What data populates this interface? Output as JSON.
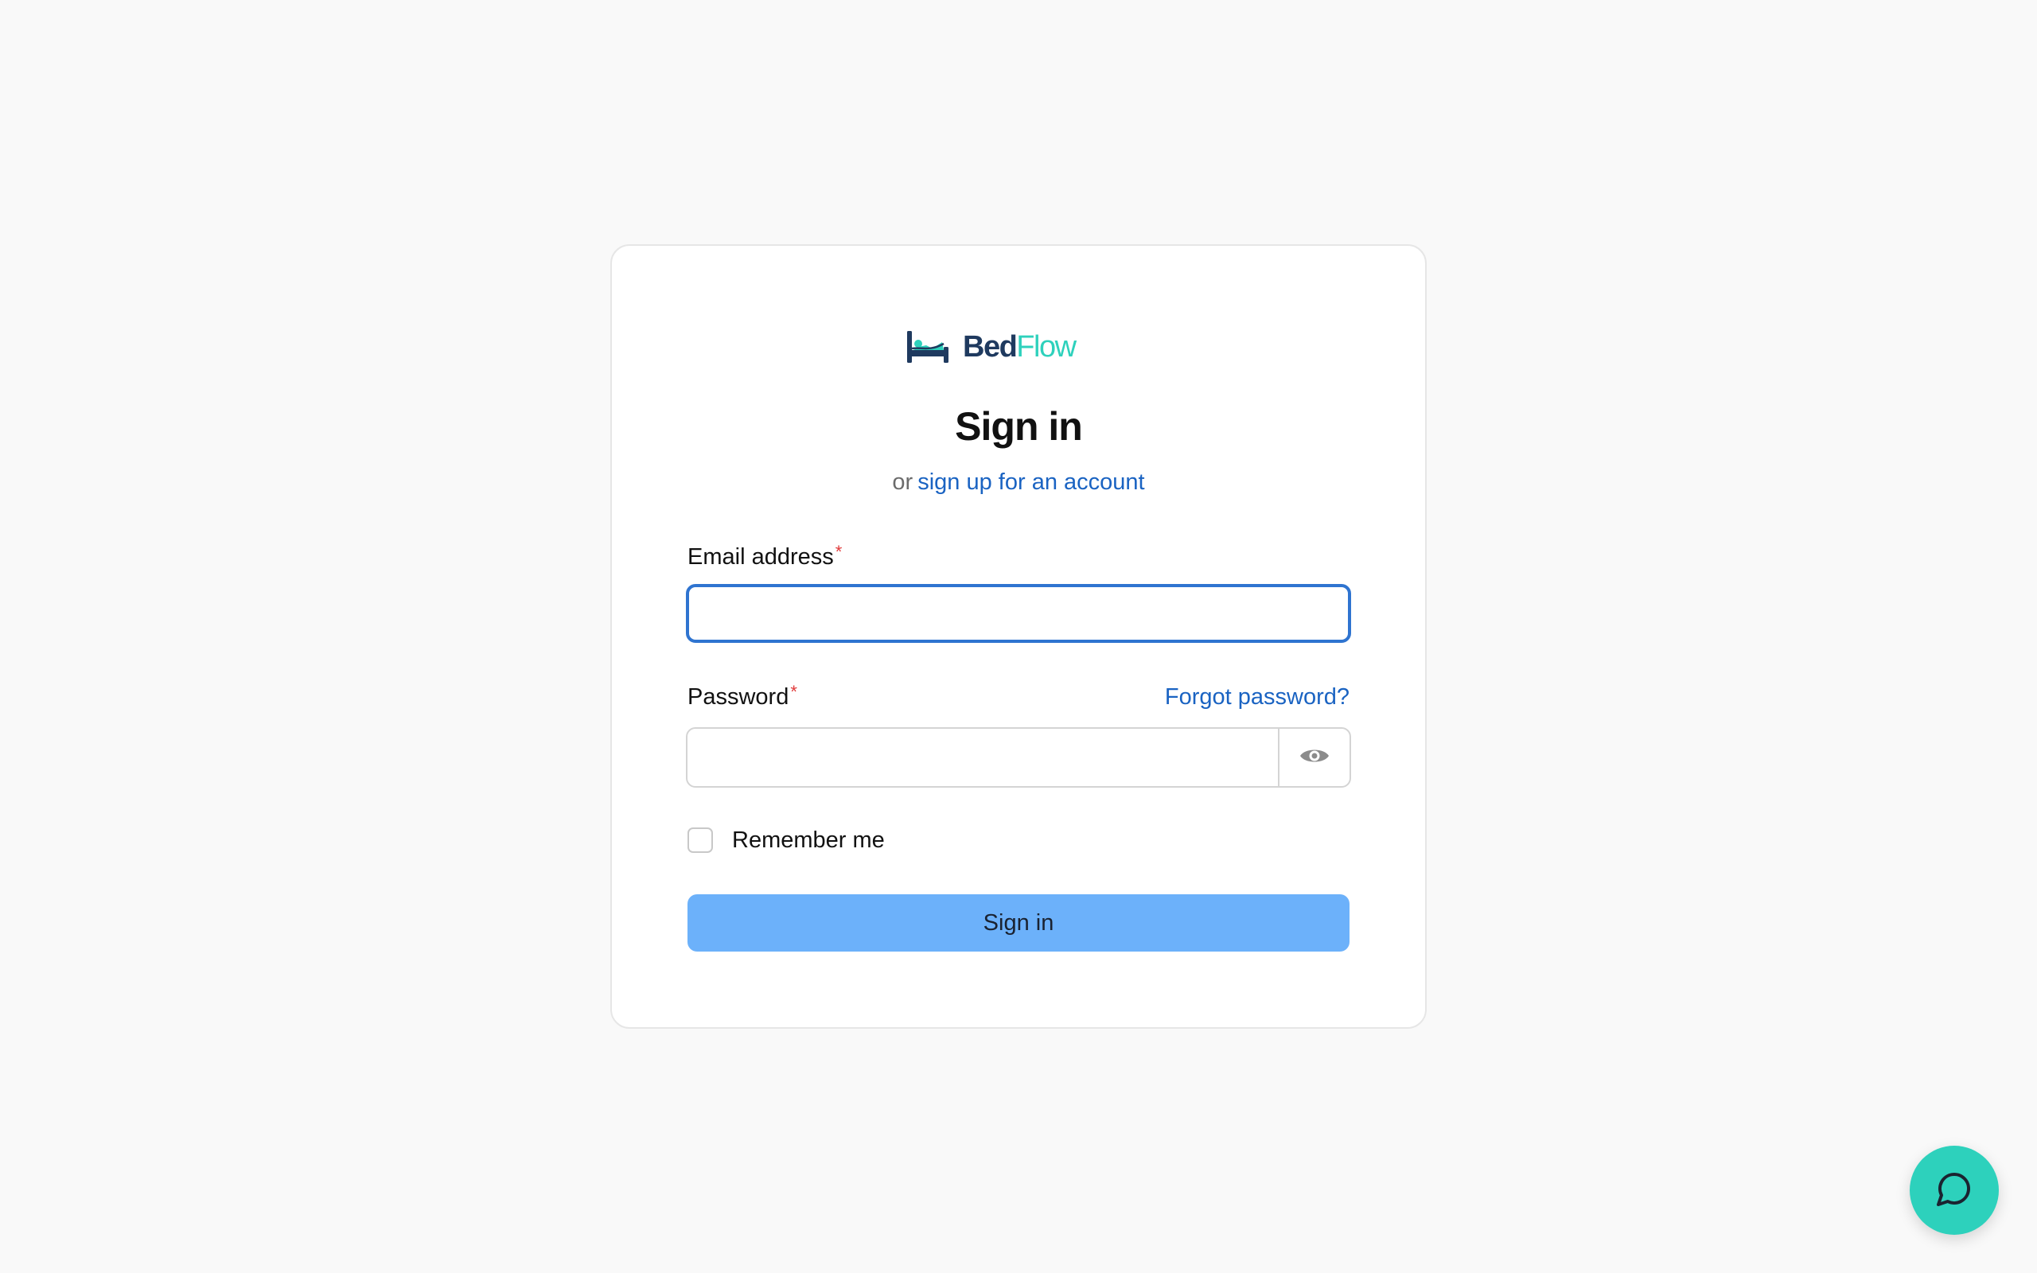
{
  "brand": {
    "name_part1": "Bed",
    "name_part2": "Flow",
    "primary_color": "#1f3a5f",
    "accent_color": "#2ed1bc",
    "logo_icon": "bed-icon"
  },
  "header": {
    "title": "Sign in",
    "subtitle_prefix": "or",
    "signup_link": "sign up for an account"
  },
  "form": {
    "email": {
      "label": "Email address",
      "required_mark": "*",
      "value": ""
    },
    "password": {
      "label": "Password",
      "required_mark": "*",
      "value": "",
      "forgot_link": "Forgot password?",
      "toggle_icon": "eye-icon"
    },
    "remember": {
      "label": "Remember me",
      "checked": false
    },
    "submit_label": "Sign in",
    "submit_color": "#6cb1fa",
    "link_color": "#1a63c2"
  },
  "chat": {
    "icon": "chat-bubble-icon",
    "color": "#2dd1bc"
  }
}
